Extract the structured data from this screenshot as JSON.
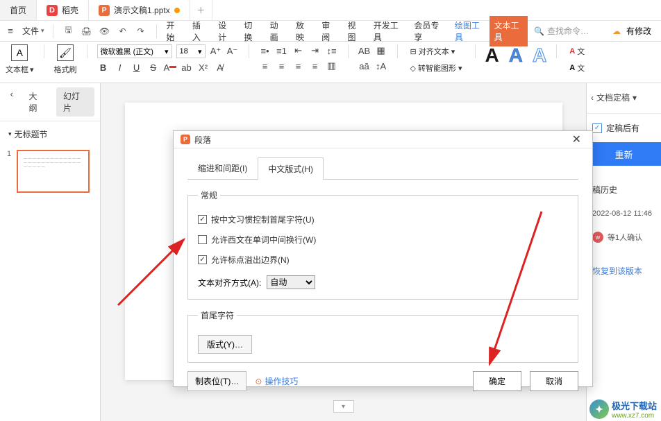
{
  "tabs": {
    "home": "首页",
    "docer": "稻壳",
    "ppt": "演示文稿1.pptx"
  },
  "menu": {
    "file": "文件",
    "items": [
      "开始",
      "插入",
      "设计",
      "切换",
      "动画",
      "放映",
      "审阅",
      "视图",
      "开发工具",
      "会员专享"
    ],
    "drawing_tools": "绘图工具",
    "text_tools": "文本工具",
    "search_placeholder": "查找命令…",
    "modify": "有修改"
  },
  "ribbon": {
    "textbox": "文本框",
    "format_painter": "格式刷",
    "font_name": "微软雅黑 (正文)",
    "font_size": "18",
    "vert_text": "对齐文本",
    "smart_shape": "转智能图形",
    "letter": "A",
    "right_section": "文"
  },
  "left": {
    "outline": "大纲",
    "slides": "幻灯片",
    "section": "无标题节",
    "slide_num": "1"
  },
  "right": {
    "doc_finalize": "文档定稿",
    "after_finalize": "定稿后有",
    "regen": "重新",
    "history": "稿历史",
    "date": "2022-08-12 11:46",
    "person": "等1人确认",
    "restore": "恢复到该版本"
  },
  "dialog": {
    "title": "段落",
    "tab1": "缩进和间距(I)",
    "tab2": "中文版式(H)",
    "general": "常规",
    "chk1": "按中文习惯控制首尾字符(U)",
    "chk2": "允许西文在单词中间换行(W)",
    "chk3": "允许标点溢出边界(N)",
    "align_label": "文本对齐方式(A):",
    "align_value": "自动",
    "首尾": "首尾字符",
    "format": "版式(Y)…",
    "tab_stops": "制表位(T)…",
    "tip": "操作技巧",
    "ok": "确定",
    "cancel": "取消"
  },
  "watermark": {
    "brand": "极光下载站",
    "url": "www.xz7.com"
  }
}
